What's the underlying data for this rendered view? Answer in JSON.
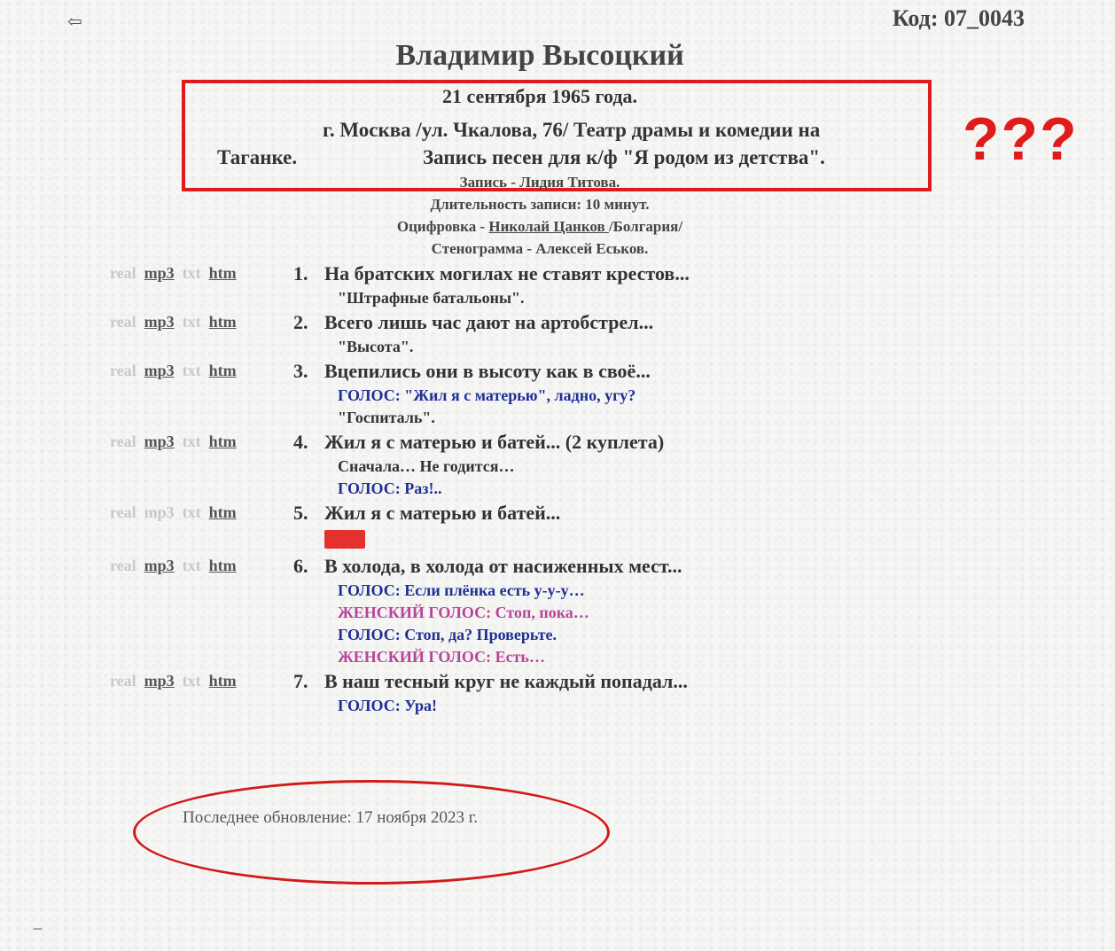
{
  "nav": {
    "back_icon": "left-arrow-icon",
    "back_glyph": "⇦"
  },
  "code": "Код: 07_0043",
  "title": "Владимир Высоцкий",
  "annotations": {
    "question_marks": "???",
    "highlight_color": "#e01b1b"
  },
  "header": {
    "date": "21 сентября 1965 года.",
    "place_line1": "г. Москва /ул. Чкалова, 76/ Театр драмы и комедии на",
    "place_line2a": "Таганке.",
    "place_line2b": "Запись песен для к/ф \"Я родом из детства\".",
    "recording": "Запись - Лидия Титова.",
    "duration": "Длительность записи: 10 минут.",
    "digitization_prefix": "Оцифровка - ",
    "digitization_name": "Николай Цанков ",
    "digitization_suffix": "/Болгария/",
    "transcript": "Стенограмма - Алексей Еськов."
  },
  "link_labels": {
    "real": "real",
    "mp3": "mp3",
    "txt": "txt",
    "htm": "htm"
  },
  "songs": [
    {
      "num": "1.",
      "title": "На братских могилах не ставят крестов...",
      "mp3_active": true,
      "notes": [
        {
          "text": "\"Штрафные батальоны\".",
          "kind": "plain"
        }
      ]
    },
    {
      "num": "2.",
      "title": "Всего лишь час дают на артобстрел...",
      "mp3_active": true,
      "notes": [
        {
          "text": "\"Высота\".",
          "kind": "plain"
        }
      ]
    },
    {
      "num": "3.",
      "title": "Вцепились они в высоту как в своё...",
      "mp3_active": true,
      "notes": [
        {
          "text": "ГОЛОС: \"Жил я с матерью\", ладно, угу?",
          "kind": "voice"
        },
        {
          "text": "\"Госпиталь\".",
          "kind": "plain"
        }
      ]
    },
    {
      "num": "4.",
      "title": "Жил я с матерью и батей... (2 куплета)",
      "mp3_active": true,
      "notes": [
        {
          "text": "Сначала… Не годится…",
          "kind": "plain"
        },
        {
          "text": "ГОЛОС: Раз!..",
          "kind": "voice"
        }
      ]
    },
    {
      "num": "5.",
      "title": "Жил я с матерью и батей...",
      "mp3_active": false,
      "notes": []
    },
    {
      "num": "6.",
      "title": "В холода, в холода от насиженных мест...",
      "mp3_active": true,
      "notes": [
        {
          "text": "ГОЛОС: Если плёнка есть у-у-у…",
          "kind": "voice"
        },
        {
          "text": "ЖЕНСКИЙ ГОЛОС: Стоп, пока…",
          "kind": "female"
        },
        {
          "text": "ГОЛОС: Стоп, да? Проверьте.",
          "kind": "voice"
        },
        {
          "text": "ЖЕНСКИЙ ГОЛОС: Есть…",
          "kind": "female"
        }
      ]
    },
    {
      "num": "7.",
      "title": "В наш тесный круг не каждый попадал...",
      "mp3_active": true,
      "notes": [
        {
          "text": "ГОЛОС: Ура!",
          "kind": "voice"
        }
      ]
    }
  ],
  "footer": {
    "updated": "Последнее обновление:  17 ноября 2023 г.",
    "dash": "_"
  },
  "colors": {
    "voice": "#1f2f96",
    "female_voice": "#b8449a",
    "annotation_red": "#e01b1b"
  }
}
